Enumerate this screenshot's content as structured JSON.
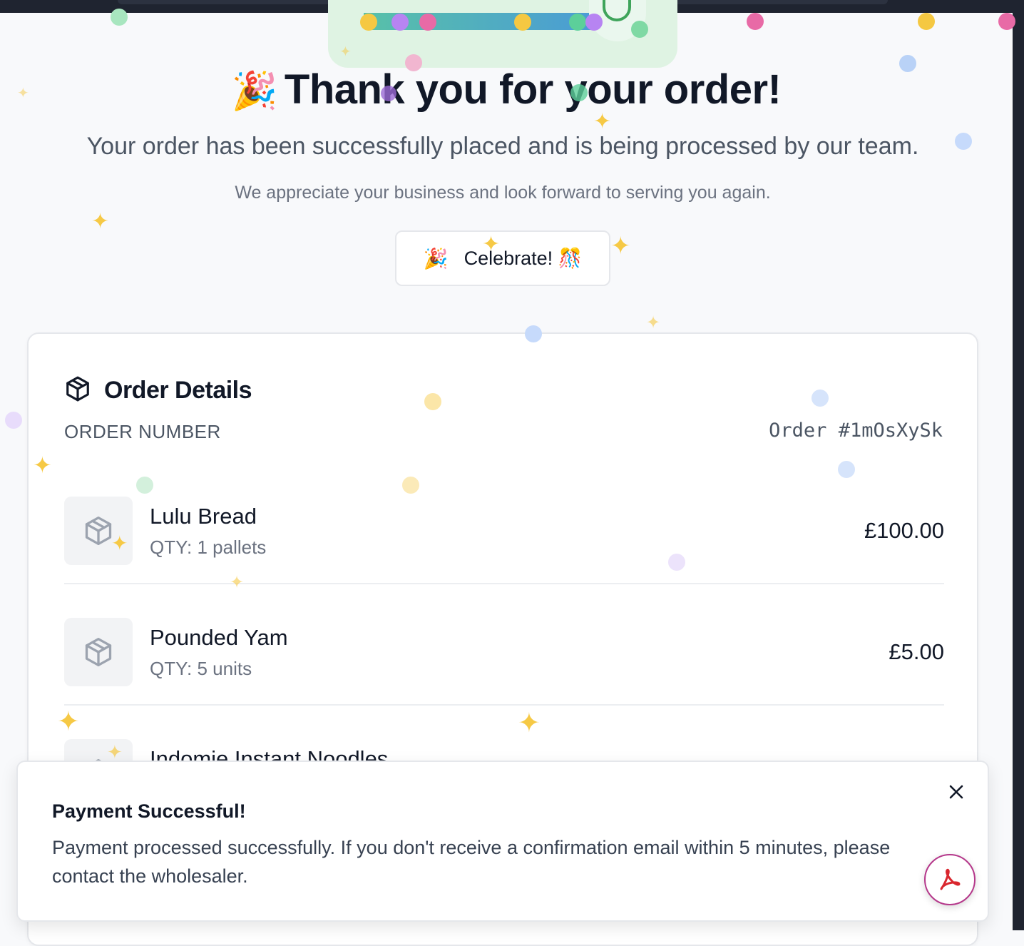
{
  "hero": {
    "title": "Thank you for your order!",
    "title_emoji": "🎉",
    "subtitle": "Your order has been successfully placed and is being processed by our team.",
    "note": "We appreciate your business and look forward to serving you again."
  },
  "celebrate_button": {
    "icon": "🎉",
    "label": "Celebrate! 🎊"
  },
  "order_details": {
    "title": "Order Details",
    "icon": "package-icon",
    "order_number_label": "ORDER NUMBER",
    "order_number_value": "Order #1mOsXySk",
    "items": [
      {
        "name": "Lulu Bread",
        "qty": "QTY: 1 pallets",
        "price": "£100.00"
      },
      {
        "name": "Pounded Yam",
        "qty": "QTY: 5 units",
        "price": "£5.00"
      },
      {
        "name": "Indomie Instant Noodles",
        "qty": "",
        "price": ""
      }
    ]
  },
  "toast": {
    "title": "Payment Successful!",
    "message": "Payment processed successfully. If you don't receive a confirmation email within 5 minutes, please contact the wholesaler."
  },
  "colors": {
    "accent_green": "#3fa45b",
    "confetti": [
      "#f5c842",
      "#b784f2",
      "#e86aa6",
      "#5ccf9a",
      "#9dbcf5"
    ]
  }
}
